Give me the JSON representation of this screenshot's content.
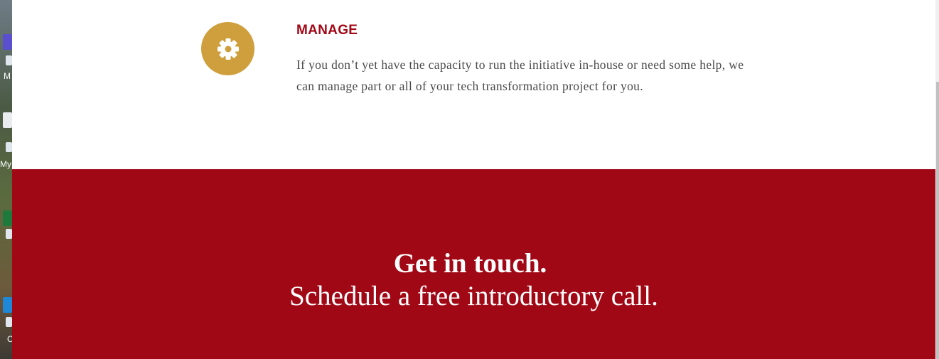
{
  "desktop": {
    "labels": [
      "M",
      "My",
      "C"
    ]
  },
  "manage": {
    "icon": "gear-icon",
    "heading": "MANAGE",
    "body": "If you don’t yet have the capacity to run the initiative in-house or need some help, we can manage part or all of your tech transformation project for you."
  },
  "cta": {
    "title": "Get in touch.",
    "subtitle": "Schedule a free introductory call."
  },
  "colors": {
    "brand_red": "#a10816",
    "gold": "#cf9f3d",
    "body_text": "#4a4a4a"
  }
}
